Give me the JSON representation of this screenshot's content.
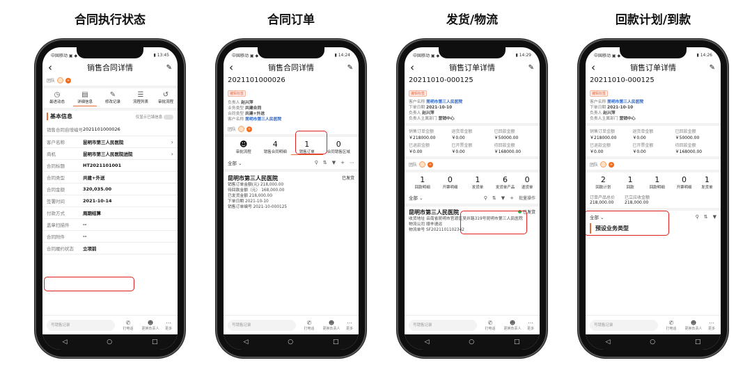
{
  "titles": [
    "合同执行状态",
    "合同订单",
    "发货/物流",
    "回款计划/到款"
  ],
  "phone1": {
    "status_left": "中国移动 ▣ ◆",
    "status_right": "▮ 13:45",
    "title": "销售合同详情",
    "team_label": "团队",
    "icons": [
      {
        "label": "最进动态",
        "icon": "timeline-icon"
      },
      {
        "label": "详细信息",
        "icon": "document-icon"
      },
      {
        "label": "修改记录",
        "icon": "edit-record-icon"
      },
      {
        "label": "流程列表",
        "icon": "process-icon"
      },
      {
        "label": "审批流程",
        "icon": "approval-icon"
      }
    ],
    "section_title": "基本信息",
    "toggle_label": "仅显示已填信息",
    "rows": [
      {
        "k": "销售合同自增编号",
        "v": "2021101000026"
      },
      {
        "k": "客户名称",
        "v": "昆明市第三人民医院",
        "chev": true
      },
      {
        "k": "商机",
        "v": "昆明市第三人民医院进院",
        "chev": true
      },
      {
        "k": "合同标题",
        "v": "HT2021101001"
      },
      {
        "k": "合同类型",
        "v": "共建+外送"
      },
      {
        "k": "合同金额",
        "v": "320,035.00"
      },
      {
        "k": "签署时间",
        "v": "2021-10-14"
      },
      {
        "k": "付款方式",
        "v": "周期结算"
      },
      {
        "k": "盖章扫描件",
        "v": "--"
      },
      {
        "k": "合同附件",
        "v": "--"
      },
      {
        "k": "合同履约状态",
        "v": "立项前"
      }
    ],
    "bottom_input": "写销售记录",
    "bottom_actions": [
      "打电话",
      "更换负责人",
      "更多"
    ]
  },
  "phone2": {
    "status_left": "中国移动 ▣ ◆",
    "status_right": "▮ 14:24",
    "title": "销售合同详情",
    "code": "2021101000026",
    "tag": "编辑标签",
    "info": [
      {
        "k": "负责人",
        "v": "赵兴萍"
      },
      {
        "k": "业务类型",
        "v": "共建合同"
      },
      {
        "k": "合同类型",
        "v": "共建+外送"
      },
      {
        "k": "客户名称",
        "v": "昆明市第三人民医院"
      }
    ],
    "team_label": "团队",
    "tabs": [
      {
        "n": "",
        "label": "审批流程"
      },
      {
        "n": "4",
        "label": "销售合同明细"
      },
      {
        "n": "1",
        "label": "销售订单"
      },
      {
        "n": "0",
        "label": "合同销售区域"
      }
    ],
    "filter_label": "全部",
    "entry": {
      "title": "昆明市第三人民医院",
      "status": "已发货",
      "lines": [
        "销售订单金额(元) 218,000.00",
        "待回款金额（元） 168,000.00",
        "已发货金额 218,000.00",
        "下单日期 2021-10-10",
        "销售订单编号 2021-10-000125"
      ]
    },
    "bottom_input": "写销售记录",
    "bottom_actions": [
      "打电话",
      "更换负责人",
      "更多"
    ]
  },
  "phone3": {
    "status_left": "中国移动 ▣ ◆",
    "status_right": "▮ 14:29",
    "title": "销售订单详情",
    "code": "20211010-000125",
    "tag": "编辑标签",
    "info": [
      {
        "k": "客户名称",
        "v": "昆明市第三人民医院"
      },
      {
        "k": "下单日期",
        "v": "2021-10-10"
      },
      {
        "k": "负责人",
        "v": "赵兴萍"
      },
      {
        "k": "负责人主属部门",
        "v": "营销中心"
      }
    ],
    "amounts": [
      {
        "lab": "销售订单金额",
        "val": "￥218000.00"
      },
      {
        "lab": "退货单金额",
        "val": "￥0.00"
      },
      {
        "lab": "已回款金额",
        "val": "￥50000.00"
      },
      {
        "lab": "已退款金额",
        "val": "￥0.00"
      },
      {
        "lab": "已开票金额",
        "val": "￥0.00"
      },
      {
        "lab": "待回款金额",
        "val": "￥168000.00"
      }
    ],
    "team_label": "团队",
    "tabs": [
      {
        "n": "1",
        "label": "回款明细"
      },
      {
        "n": "0",
        "label": "开票明细"
      },
      {
        "n": "1",
        "label": "发货单"
      },
      {
        "n": "6",
        "label": "发货单产品"
      },
      {
        "n": "0",
        "label": "退货单"
      }
    ],
    "filter_label": "全部",
    "batch_label": "批量操作",
    "entry": {
      "title": "昆明市第三人民医院",
      "status": "已发货",
      "lines": [
        "收货地址 云南省昆明市官渡区吴井路319号昆明市第三人民医院",
        "物流公司 顺丰速运",
        "物流单号 SF2021101102342"
      ]
    },
    "bottom_input": "写销售记录",
    "bottom_actions": [
      "打电话",
      "更换负责人",
      "更多"
    ]
  },
  "phone4": {
    "status_left": "中国移动 ▣ ◆",
    "status_right": "▮ 14:26",
    "title": "销售订单详情",
    "code": "20211010-000125",
    "tag": "编辑标签",
    "info": [
      {
        "k": "客户名称",
        "v": "昆明市第三人民医院"
      },
      {
        "k": "下单日期",
        "v": "2021-10-10"
      },
      {
        "k": "负责人",
        "v": "赵兴萍"
      },
      {
        "k": "负责人主属部门",
        "v": "营销中心"
      }
    ],
    "amounts": [
      {
        "lab": "销售订单金额",
        "val": "￥218000.00"
      },
      {
        "lab": "退货单金额",
        "val": "￥0.00"
      },
      {
        "lab": "已回款金额",
        "val": "￥50000.00"
      },
      {
        "lab": "已退款金额",
        "val": "￥0.00"
      },
      {
        "lab": "已开票金额",
        "val": "￥0.00"
      },
      {
        "lab": "待回款金额",
        "val": "￥168000.00"
      }
    ],
    "team_label": "团队",
    "tabs": [
      {
        "n": "2",
        "label": "回款计划"
      },
      {
        "n": "1",
        "label": "回款"
      },
      {
        "n": "1",
        "label": "回款明细"
      },
      {
        "n": "0",
        "label": "开票明细"
      },
      {
        "n": "1",
        "label": "发货单"
      }
    ],
    "totals": [
      {
        "lab": "订单产品总价",
        "val": "218,000.00"
      },
      {
        "lab": "已立应收金额",
        "val": "218,000.00"
      }
    ],
    "filter_label": "全部",
    "section": "预设业务类型",
    "bottom_input": "写销售记录",
    "bottom_actions": [
      "打电话",
      "更换负责人",
      "更多"
    ]
  },
  "nav": [
    "◁",
    "○",
    "□"
  ]
}
